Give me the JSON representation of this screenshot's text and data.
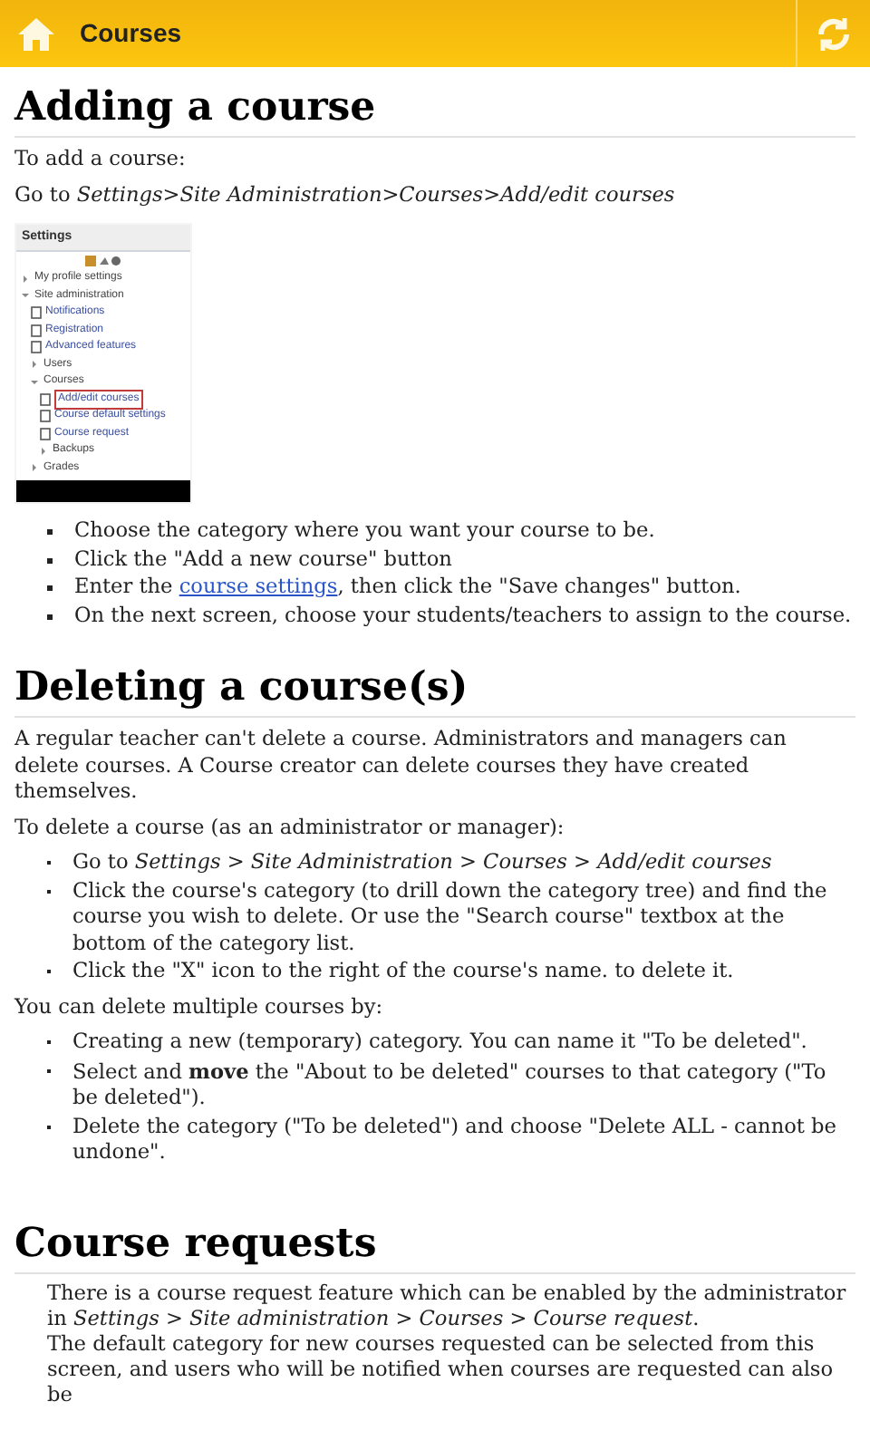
{
  "action_bar": {
    "title": "Courses"
  },
  "sections": [
    {
      "heading": "Adding a course",
      "blocks": [
        {
          "kind": "paragraph",
          "text": "To add a course:"
        },
        {
          "kind": "paragraph",
          "text": "Go to *Settings>Site Administration>Courses>Add/edit courses*"
        },
        {
          "kind": "screenshot",
          "title": "Settings",
          "tree": [
            {
              "label": "My profile settings",
              "kind": "folder",
              "expanded": false
            },
            {
              "label": "Site administration",
              "kind": "folder",
              "expanded": true,
              "children": [
                {
                  "label": "Notifications",
                  "kind": "page",
                  "highlighted": false
                },
                {
                  "label": "Registration",
                  "kind": "page",
                  "highlighted": false
                },
                {
                  "label": "Advanced features",
                  "kind": "page",
                  "highlighted": false
                },
                {
                  "label": "Users",
                  "kind": "folder",
                  "expanded": false
                },
                {
                  "label": "Courses",
                  "kind": "folder",
                  "expanded": true,
                  "children": [
                    {
                      "label": "Add/edit courses",
                      "kind": "page",
                      "highlighted": true
                    },
                    {
                      "label": "Course default settings",
                      "kind": "page",
                      "highlighted": false
                    },
                    {
                      "label": "Course request",
                      "kind": "page",
                      "highlighted": false
                    },
                    {
                      "label": "Backups",
                      "kind": "folder",
                      "expanded": false
                    }
                  ]
                },
                {
                  "label": "Grades",
                  "kind": "folder",
                  "expanded": false
                }
              ]
            }
          ]
        },
        {
          "kind": "list",
          "items": [
            {
              "text": "Choose the category where you want your course to be."
            },
            {
              "text": "Click the \"Add a new course\" button"
            },
            {
              "text": "Enter the ",
              "link": "course settings",
              "after": ", then click the \"Save changes\" button."
            },
            {
              "text": "On the next screen, choose your students/teachers to assign to the course."
            }
          ]
        }
      ]
    },
    {
      "heading": "Deleting a course(s)",
      "blocks": [
        {
          "kind": "paragraph",
          "text": "A regular teacher can't delete a course. Administrators and managers can delete courses. A Course creator can delete courses they have created themselves."
        },
        {
          "kind": "paragraph",
          "text": "To delete a course (as an administrator or manager):"
        },
        {
          "kind": "list",
          "items": [
            {
              "text": "Go to *Settings > Site Administration > Courses > Add/edit courses*"
            },
            {
              "text": "Click the course's category (to drill down the category tree) and find the course you wish to delete. Or use the \"Search course\" textbox at the bottom of the category list."
            },
            {
              "text": "Click the \"X\" icon to the right of the course's name. to delete it."
            }
          ]
        },
        {
          "kind": "paragraph",
          "text": "You can delete multiple courses by:"
        },
        {
          "kind": "list",
          "items": [
            {
              "text": "Creating a new (temporary) category. You can name it \"To be deleted\"."
            },
            {
              "text": "Select and **move** the \"About to be deleted\" courses to that category (\"To be deleted\")."
            },
            {
              "text": "Delete the category (\"To be deleted\") and choose \"Delete ALL - cannot be undone\"."
            }
          ]
        }
      ]
    },
    {
      "heading": "Course requests",
      "blocks": [
        {
          "kind": "indented",
          "text": "There is a course request feature which can be enabled by the administrator in *Settings > Site administration > Courses > Course request*."
        },
        {
          "kind": "indented",
          "text": "The default category for new courses requested can be selected from this screen, and users who will be notified when courses are requested can also be"
        }
      ]
    }
  ]
}
